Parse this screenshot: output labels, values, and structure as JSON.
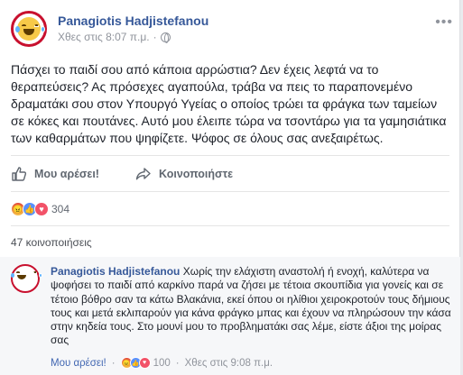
{
  "post": {
    "author": "Panagiotis Hadjistefanou",
    "timestamp": "Χθες στις 8:07 π.μ.",
    "audience_icon": "globe-icon",
    "more_label": "•••",
    "text": "Πάσχει το παιδί σου από κάποια αρρώστια? Δεν έχεις λεφτά να το θεραπεύσεις? Ας πρόσεχες αγαπούλα, τράβα να πεις το παραπονεμένο δραματάκι σου στον Υπουργό Υγείας ο οποίος τρώει τα φράγκα των ταμείων σε κόκες και πουτάνες. Αυτό μου έλειπε τώρα να τσοντάρω για τα γαμησιάτικα των καθαρμάτων που ψηφίζετε. Ψόφος σε όλους σας ανεξαιρέτως."
  },
  "actions": {
    "like_label": "Μου αρέσει!",
    "share_label": "Κοινοποιήστε"
  },
  "reactions": {
    "count": "304",
    "types": [
      "angry",
      "like",
      "love"
    ]
  },
  "shares": {
    "label": "47 κοινοποιήσεις"
  },
  "comment": {
    "author": "Panagiotis Hadjistefanou",
    "text": " Χωρίς την ελάχιστη αναστολή ή ενοχή, καλύτερα να ψοφήσει το παιδί από καρκίνο παρά να ζήσει με τέτοια σκουπίδια για γονείς και σε τέτοιο βόθρο σαν τα κάτω Βλακάνια, εκεί όπου οι ηλίθιοι χειροκροτούν τους δήμιους τους και μετά εκλιπαρούν για κάνα φράγκο μπας και έχουν να πληρώσουν την κάσα στην κηδεία τους. Στο μουνί μου το προβληματάκι σας λέμε, είστε άξιοι της μοίρας σας",
    "like_label": "Μου αρέσει!",
    "separator": "·",
    "reaction_count": "100",
    "timestamp": "Χθες στις 9:08 π.μ."
  },
  "colors": {
    "link": "#365899",
    "muted": "#90949c",
    "avatar_ring": "#c8102e"
  }
}
